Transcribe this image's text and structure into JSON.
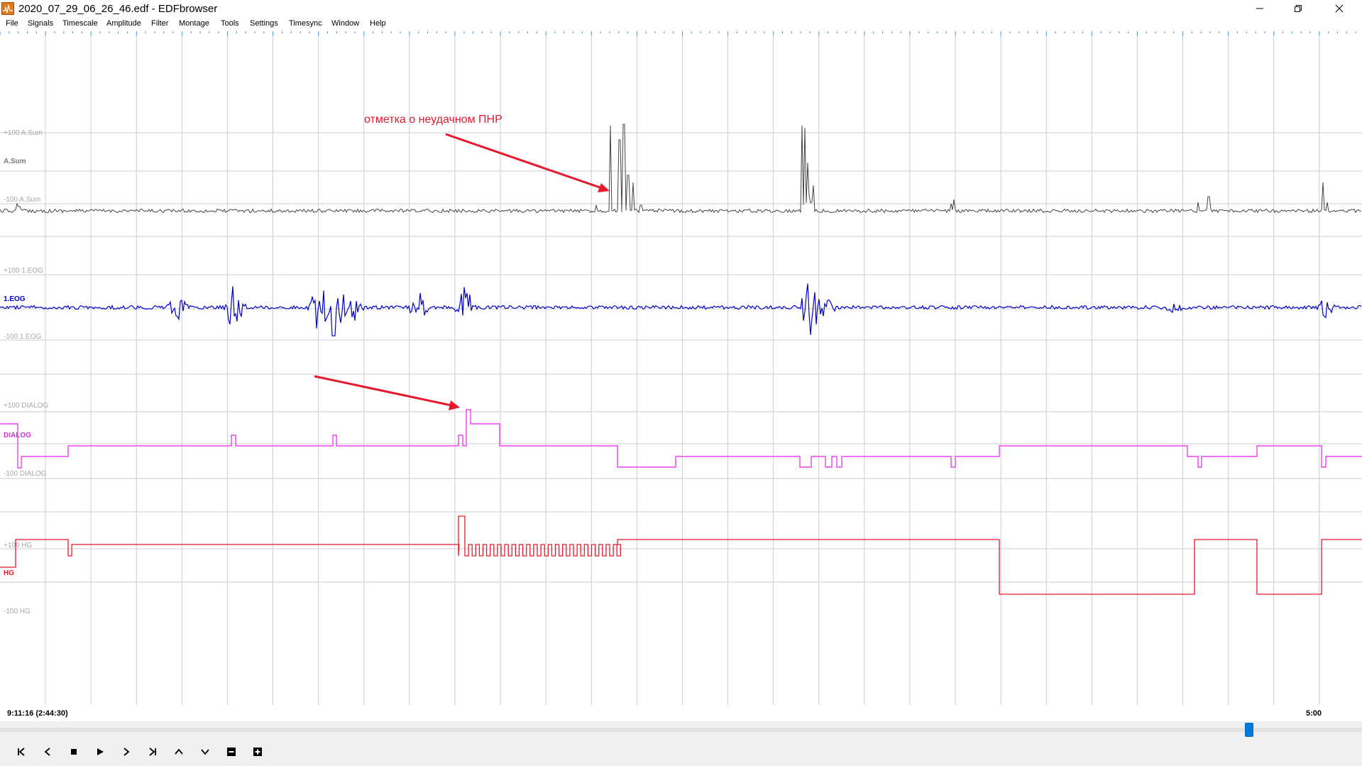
{
  "window": {
    "title": "2020_07_29_06_26_46.edf - EDFbrowser",
    "icon": "edf-app-icon",
    "controls": [
      "minimize-icon",
      "restore-icon",
      "close-icon"
    ]
  },
  "menu": [
    "File",
    "Signals",
    "Timescale",
    "Amplitude",
    "Filter",
    "Montage",
    "Tools",
    "Settings",
    "Timesync",
    "Window",
    "Help"
  ],
  "signals": [
    {
      "name": "A.Sum",
      "upper_label": "+100 A.Sum",
      "lower_label": "-100 A.Sum",
      "color": "#444444",
      "label_color": "#7a7a7a"
    },
    {
      "name": "1.EOG",
      "upper_label": "+100 1.EOG",
      "lower_label": "-100 1.EOG",
      "color": "#0000cc",
      "label_color": "#0000cc"
    },
    {
      "name": "DIALOG",
      "upper_label": "+100 DIALOG",
      "lower_label": "-100 DIALOG",
      "color": "#ee40ee",
      "label_color": "#d92ed9"
    },
    {
      "name": "HG",
      "upper_label": "+100 HG",
      "lower_label": "-100 HG",
      "color": "#e8192c",
      "label_color": "#e8192c"
    }
  ],
  "annotations": [
    {
      "text": "отметка о неудачном ПНР",
      "color": "#e8192c"
    }
  ],
  "timebar": {
    "left": "9:11:16 (2:44:30)",
    "right": "5:00"
  },
  "scroll_position": 0.92,
  "toolbar": [
    "skip-start-icon",
    "prev-icon",
    "stop-icon",
    "play-icon",
    "next-icon",
    "skip-end-icon",
    "amplitude-up-icon",
    "amplitude-down-icon",
    "zoom-out-icon",
    "zoom-in-icon"
  ],
  "colors": {
    "grid": "#c8cdd6",
    "tick": "#4a8fd8",
    "arrow": "#e8192c",
    "accent": "#0078d7"
  }
}
